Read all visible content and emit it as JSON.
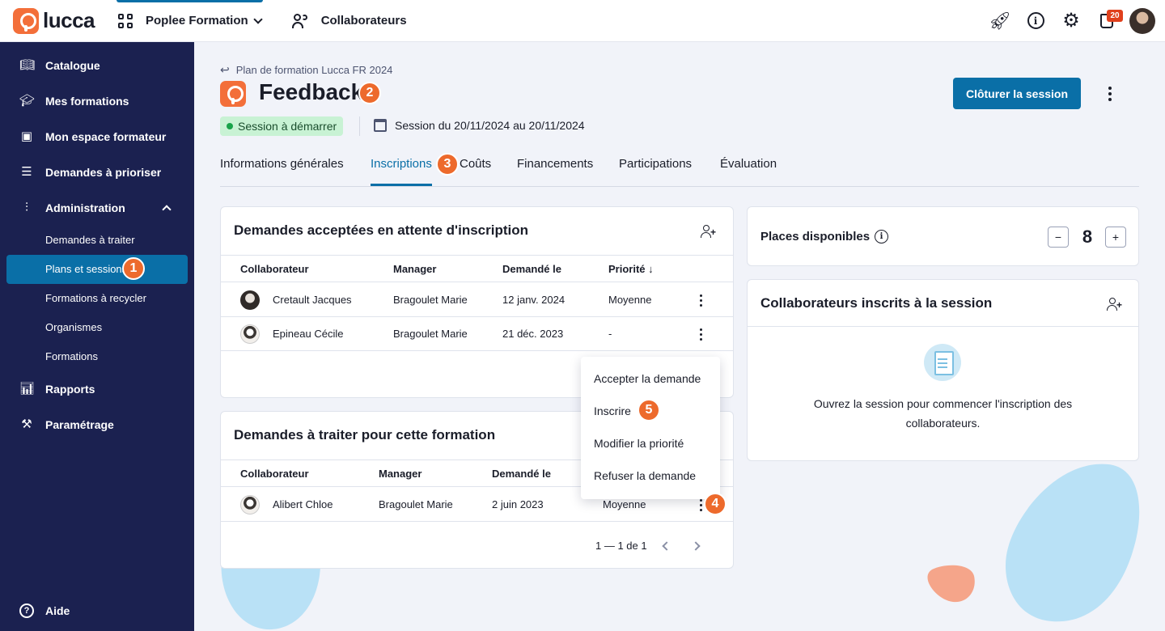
{
  "topbar": {
    "brand": "lucca",
    "app_title": "Poplee Formation",
    "collaborateurs": "Collaborateurs",
    "notifications_count": "20"
  },
  "sidebar": {
    "items": [
      {
        "label": "Catalogue",
        "icon": "book-icon"
      },
      {
        "label": "Mes formations",
        "icon": "graduation-cap-icon"
      },
      {
        "label": "Mon espace formateur",
        "icon": "trainer-board-icon"
      },
      {
        "label": "Demandes à prioriser",
        "icon": "list-priority-icon"
      },
      {
        "label": "Administration",
        "icon": "sliders-icon"
      }
    ],
    "admin_sub": [
      "Demandes à traiter",
      "Plans et sessions",
      "Formations à recycler",
      "Organismes",
      "Formations"
    ],
    "bottom_items": [
      {
        "label": "Rapports",
        "icon": "chart-icon"
      },
      {
        "label": "Paramétrage",
        "icon": "tools-icon"
      }
    ],
    "help": "Aide"
  },
  "steps": [
    "1",
    "2",
    "3",
    "4",
    "5"
  ],
  "page": {
    "breadcrumb": "Plan de formation Lucca FR 2024",
    "title": "Feedback",
    "status": "Session à démarrer",
    "session_dates": "Session du 20/11/2024 au 20/11/2024",
    "close_button": "Clôturer la session"
  },
  "tabs": [
    "Informations générales",
    "Inscriptions",
    "Coûts",
    "Financements",
    "Participations",
    "Évaluation"
  ],
  "accepted_card": {
    "title": "Demandes acceptées en attente d'inscription",
    "columns": [
      "Collaborateur",
      "Manager",
      "Demandé le",
      "Priorité ↓"
    ],
    "rows": [
      {
        "collaborateur": "Cretault Jacques",
        "manager": "Bragoulet Marie",
        "date": "12 janv. 2024",
        "priorite": "Moyenne"
      },
      {
        "collaborateur": "Epineau Cécile",
        "manager": "Bragoulet Marie",
        "date": "21 déc. 2023",
        "priorite": "-"
      }
    ]
  },
  "pending_card": {
    "title": "Demandes à traiter pour cette formation",
    "columns": [
      "Collaborateur",
      "Manager",
      "Demandé le"
    ],
    "rows": [
      {
        "collaborateur": "Alibert Chloe",
        "manager": "Bragoulet Marie",
        "date": "2 juin 2023",
        "priorite": "Moyenne"
      }
    ],
    "pagination": "1 — 1 de 1"
  },
  "context_menu": [
    "Accepter la demande",
    "Inscrire",
    "Modifier la priorité",
    "Refuser la demande"
  ],
  "places": {
    "label": "Places disponibles",
    "value": "8",
    "minus": "−",
    "plus": "+"
  },
  "enrolled_card": {
    "title": "Collaborateurs inscrits à la session",
    "empty_text": "Ouvrez la session pour commencer l'inscription des collaborateurs."
  },
  "colors": {
    "primary": "#0a6fa7",
    "sidebar": "#1b2150",
    "accent": "#ed6a2c",
    "success_bg": "#c8f2d4"
  }
}
